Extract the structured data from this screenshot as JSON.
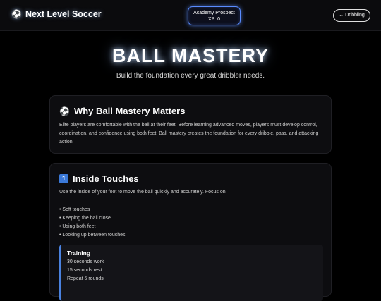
{
  "header": {
    "brand_icon": "soccer-ball-icon",
    "brand_name": "Next Level Soccer",
    "prospect_title": "Academy Prospect",
    "prospect_xp": "XP: 0",
    "back_label": "← Dribbling"
  },
  "hero": {
    "title": "BALL MASTERY",
    "subtitle": "Build the foundation every great dribbler needs."
  },
  "section1": {
    "icon": "⚽",
    "title": "Why Ball Mastery Matters",
    "text": "Elite players are comfortable with the ball at their feet. Before learning advanced moves, players must develop control, coordination, and confidence using both feet. Ball mastery creates the foundation for every dribble, pass, and attacking action."
  },
  "section2": {
    "number": "1",
    "title": "Inside Touches",
    "intro": "Use the inside of your foot to move the ball quickly and accurately. Focus on:",
    "bullets": [
      "Soft touches",
      "Keeping the ball close",
      "Using both feet",
      "Looking up between touches"
    ],
    "training": {
      "title": "Training",
      "lines": [
        "30 seconds work",
        "15 seconds rest",
        "Repeat 5 rounds"
      ]
    }
  },
  "colors": {
    "background": "#000000",
    "accent_blue": "#5a8cff",
    "card_bg": "#0d0d10"
  }
}
